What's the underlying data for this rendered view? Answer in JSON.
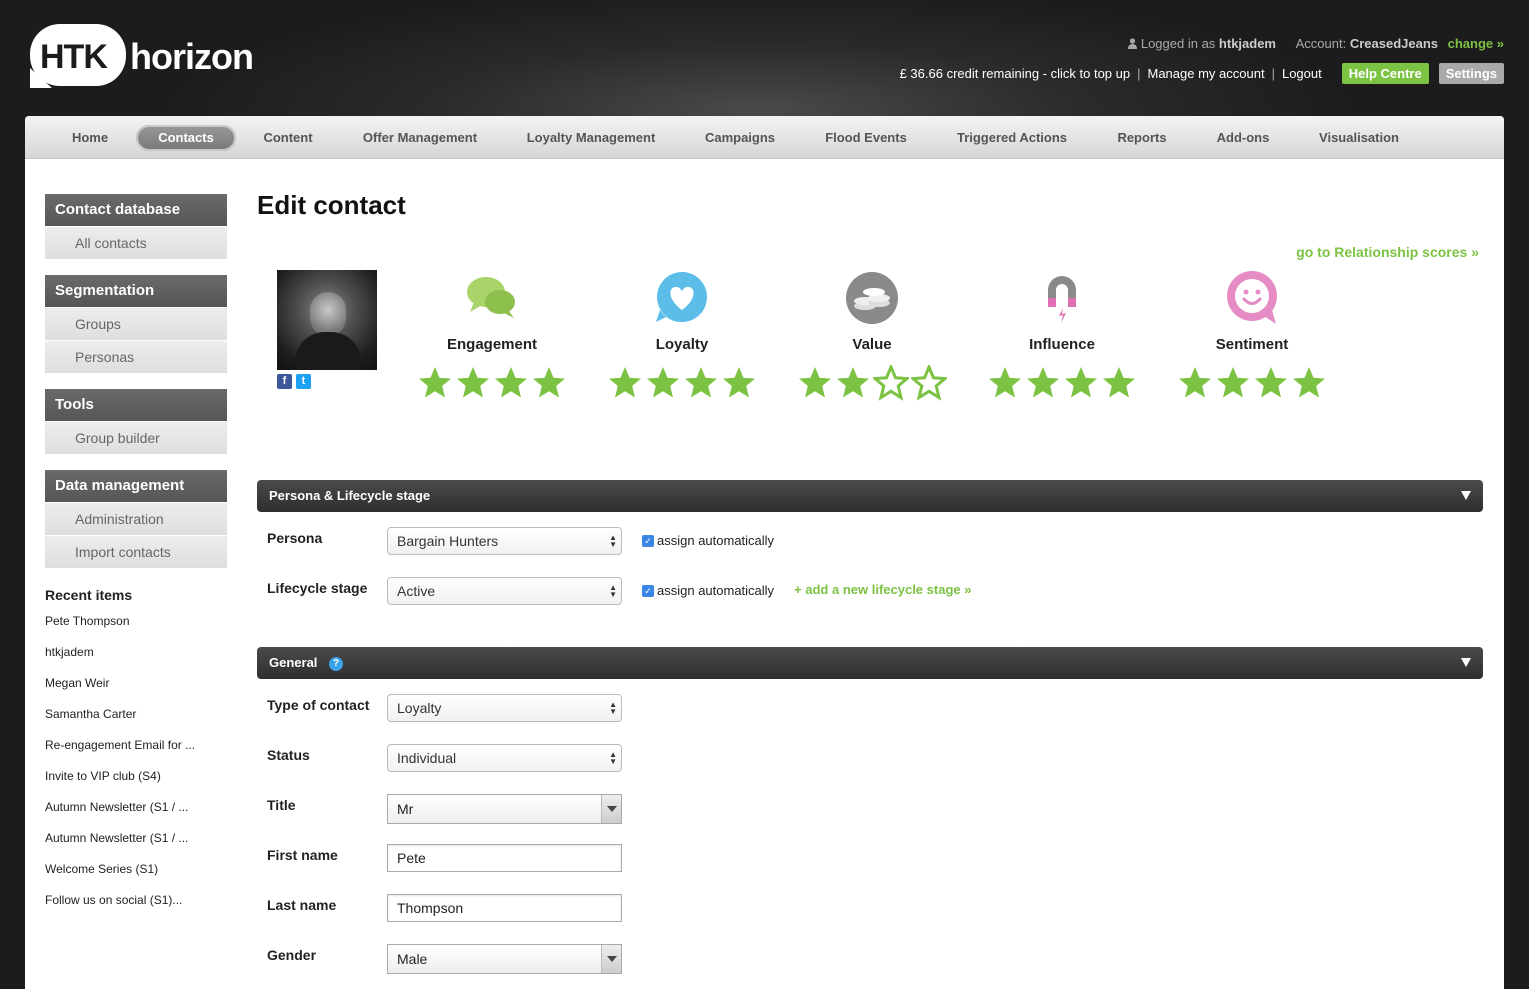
{
  "header": {
    "logo_mark": "HTK",
    "logo_word": "horizon",
    "logged_in_prefix": "Logged in as",
    "username": "htkjadem",
    "account_prefix": "Account:",
    "account_name": "CreasedJeans",
    "change_link": "change »",
    "credit_text": "£ 36.66 credit remaining - click to top up",
    "manage_account": "Manage my account",
    "logout": "Logout",
    "help_centre": "Help Centre",
    "settings": "Settings"
  },
  "nav": {
    "items": [
      "Home",
      "Contacts",
      "Content",
      "Offer Management",
      "Loyalty Management",
      "Campaigns",
      "Flood Events",
      "Triggered Actions",
      "Reports",
      "Add-ons",
      "Visualisation"
    ],
    "active": "Contacts"
  },
  "sidebar": {
    "groups": [
      {
        "title": "Contact database",
        "items": [
          "All contacts"
        ]
      },
      {
        "title": "Segmentation",
        "items": [
          "Groups",
          "Personas"
        ]
      },
      {
        "title": "Tools",
        "items": [
          "Group builder"
        ]
      },
      {
        "title": "Data management",
        "items": [
          "Administration",
          "Import contacts"
        ]
      }
    ],
    "recent_title": "Recent items",
    "recent_items": [
      "Pete Thompson",
      "htkjadem",
      "Megan Weir",
      "Samantha Carter",
      "Re-engagement Email for ...",
      "Invite to VIP club (S4)",
      "Autumn Newsletter (S1 / ...",
      "Autumn Newsletter (S1 / ...",
      "Welcome Series (S1)",
      "Follow us on social (S1)..."
    ]
  },
  "main": {
    "page_title": "Edit contact",
    "relationship_link": "go to Relationship scores »",
    "social": {
      "facebook_icon": "facebook-icon",
      "twitter_icon": "twitter-icon",
      "facebook_glyph": "f",
      "twitter_glyph": "t"
    },
    "scores": [
      {
        "label": "Engagement",
        "icon": "speech-bubbles-icon",
        "color": "#a9d46a",
        "stars": 4
      },
      {
        "label": "Loyalty",
        "icon": "heart-icon",
        "color": "#5bbde8",
        "stars": 4
      },
      {
        "label": "Value",
        "icon": "coins-icon",
        "color": "#8a8a8a",
        "stars": 2
      },
      {
        "label": "Influence",
        "icon": "magnet-icon",
        "color": "#e06fb3",
        "stars": 4
      },
      {
        "label": "Sentiment",
        "icon": "smiley-icon",
        "color": "#e68cc4",
        "stars": 4
      }
    ],
    "persona_section": {
      "title": "Persona & Lifecycle stage",
      "persona_label": "Persona",
      "persona_value": "Bargain Hunters",
      "persona_auto": "assign automatically",
      "lifecycle_label": "Lifecycle stage",
      "lifecycle_value": "Active",
      "lifecycle_auto": "assign automatically",
      "add_lifecycle": "+ add a new lifecycle stage »"
    },
    "general_section": {
      "title": "General",
      "help_glyph": "?",
      "type_label": "Type of contact",
      "type_value": "Loyalty",
      "status_label": "Status",
      "status_value": "Individual",
      "title_label": "Title",
      "title_value": "Mr",
      "first_name_label": "First name",
      "first_name_value": "Pete",
      "last_name_label": "Last name",
      "last_name_value": "Thompson",
      "gender_label": "Gender",
      "gender_value": "Male"
    }
  },
  "colors": {
    "accent_green": "#7cc243",
    "star_green": "#7cc243",
    "dark_bar": "#3a3a3a"
  }
}
